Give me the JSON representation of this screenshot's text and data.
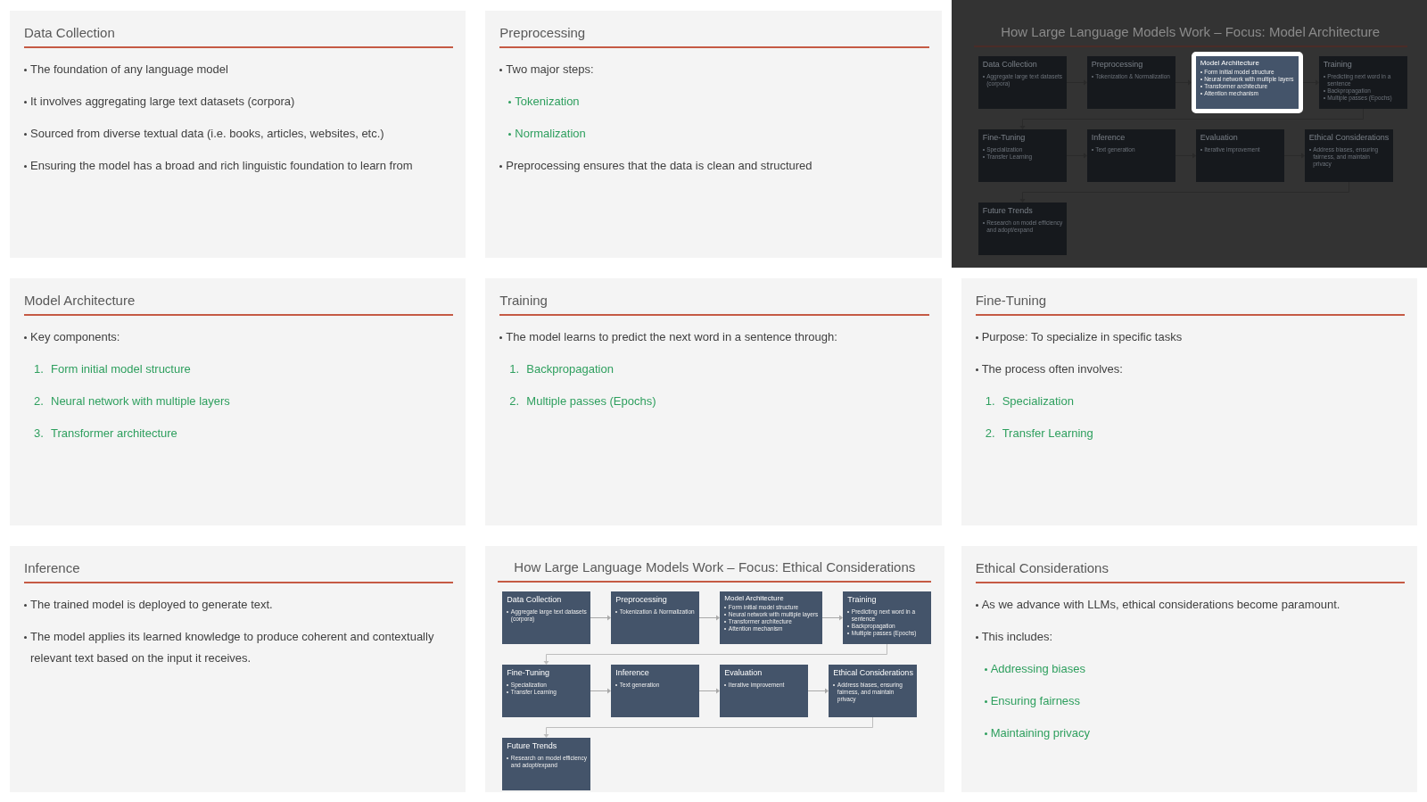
{
  "slides": [
    {
      "kind": "text",
      "dimmed": false,
      "title": "Data Collection",
      "items": [
        {
          "kind": "bullet",
          "text": "The foundation of any language model"
        },
        {
          "kind": "bullet",
          "text": "It involves aggregating large text datasets (corpora)"
        },
        {
          "kind": "bullet",
          "text": "Sourced from diverse textual data (i.e. books, articles, websites, etc.)"
        },
        {
          "kind": "bullet",
          "text": "Ensuring the model has a broad and rich linguistic foundation to learn from"
        }
      ]
    },
    {
      "kind": "text",
      "dimmed": false,
      "title": "Preprocessing",
      "items": [
        {
          "kind": "bullet",
          "text": "Two major steps:"
        },
        {
          "kind": "sub_bullet",
          "text": "Tokenization"
        },
        {
          "kind": "sub_bullet",
          "text": "Normalization"
        },
        {
          "kind": "bullet",
          "text": "Preprocessing ensures that the data is clean and structured"
        }
      ]
    },
    {
      "kind": "diagram",
      "dimmed": true,
      "title": "How Large Language Models Work – Focus: Model Architecture",
      "rows": [
        {
          "boxes": [
            {
              "title": "Data Collection",
              "selected": false,
              "bullets": [
                "Aggregate large text datasets (corpora)"
              ]
            },
            {
              "title": "Preprocessing",
              "selected": false,
              "bullets": [
                "Tokenization & Normalization"
              ]
            },
            {
              "title": "Model Architecture",
              "selected": true,
              "bullets": [
                "Form initial model structure",
                "Neural network with multiple layers",
                "Transformer architecture",
                "Attention mechanism"
              ]
            },
            {
              "title": "Training",
              "selected": false,
              "bullets": [
                "Predicting next word in a sentence",
                "Backpropagation",
                "Multiple passes (Epochs)"
              ]
            }
          ]
        },
        {
          "boxes": [
            {
              "title": "Fine-Tuning",
              "selected": false,
              "bullets": [
                "Specialization",
                "Transfer Learning"
              ]
            },
            {
              "title": "Inference",
              "selected": false,
              "bullets": [
                "Text generation"
              ]
            },
            {
              "title": "Evaluation",
              "selected": false,
              "bullets": [
                "Iterative improvement"
              ]
            },
            {
              "title": "Ethical Considerations",
              "selected": false,
              "bullets": [
                "Address biases, ensuring fairness, and maintain privacy"
              ]
            }
          ]
        },
        {
          "boxes": [
            {
              "title": "Future Trends",
              "selected": false,
              "bullets": [
                "Research on model efficiency and adopt/expand"
              ]
            }
          ]
        }
      ]
    },
    {
      "kind": "text",
      "dimmed": false,
      "title": "Model Architecture",
      "items": [
        {
          "kind": "bullet",
          "text": "Key components:"
        },
        {
          "kind": "numbered",
          "number": "1.",
          "text": "Form initial model structure"
        },
        {
          "kind": "numbered",
          "number": "2.",
          "text": "Neural network with multiple layers"
        },
        {
          "kind": "numbered",
          "number": "3.",
          "text": "Transformer architecture"
        }
      ]
    },
    {
      "kind": "text",
      "dimmed": false,
      "title": "Training",
      "items": [
        {
          "kind": "bullet",
          "text": "The model learns to predict the next word in a sentence through:"
        },
        {
          "kind": "numbered",
          "number": "1.",
          "text": "Backpropagation"
        },
        {
          "kind": "numbered",
          "number": "2.",
          "text": "Multiple passes (Epochs)"
        }
      ]
    },
    {
      "kind": "text",
      "dimmed": false,
      "title": "Fine-Tuning",
      "items": [
        {
          "kind": "bullet",
          "text": "Purpose: To specialize in specific tasks"
        },
        {
          "kind": "bullet",
          "text": "The process often involves:"
        },
        {
          "kind": "numbered",
          "number": "1.",
          "text": "Specialization"
        },
        {
          "kind": "numbered",
          "number": "2.",
          "text": "Transfer Learning"
        }
      ]
    },
    {
      "kind": "text",
      "dimmed": false,
      "title": "Inference",
      "items": [
        {
          "kind": "bullet",
          "text": "The trained model is deployed to generate text."
        },
        {
          "kind": "bullet",
          "text": "The model applies its learned knowledge to produce coherent and contextually relevant text based on the input it receives."
        }
      ]
    },
    {
      "kind": "diagram",
      "dimmed": false,
      "title": "How Large Language Models Work – Focus: Ethical Considerations",
      "rows": [
        {
          "boxes": [
            {
              "title": "Data Collection",
              "selected": false,
              "bullets": [
                "Aggregate large text datasets (corpora)"
              ]
            },
            {
              "title": "Preprocessing",
              "selected": false,
              "bullets": [
                "Tokenization & Normalization"
              ]
            },
            {
              "title": "Model Architecture",
              "selected": false,
              "bullets": [
                "Form initial model structure",
                "Neural network with multiple layers",
                "Transformer architecture",
                "Attention mechanism"
              ]
            },
            {
              "title": "Training",
              "selected": false,
              "bullets": [
                "Predicting next word in a sentence",
                "Backpropagation",
                "Multiple passes (Epochs)"
              ]
            }
          ]
        },
        {
          "boxes": [
            {
              "title": "Fine-Tuning",
              "selected": false,
              "bullets": [
                "Specialization",
                "Transfer Learning"
              ]
            },
            {
              "title": "Inference",
              "selected": false,
              "bullets": [
                "Text generation"
              ]
            },
            {
              "title": "Evaluation",
              "selected": false,
              "bullets": [
                "Iterative improvement"
              ]
            },
            {
              "title": "Ethical Considerations",
              "selected": false,
              "bullets": [
                "Address biases, ensuring fairness, and maintain privacy"
              ]
            }
          ]
        },
        {
          "boxes": [
            {
              "title": "Future Trends",
              "selected": false,
              "bullets": [
                "Research on model efficiency and adopt/expand"
              ]
            }
          ]
        }
      ]
    },
    {
      "kind": "text",
      "dimmed": false,
      "title": "Ethical Considerations",
      "items": [
        {
          "kind": "bullet",
          "text": "As we advance with LLMs, ethical considerations become paramount."
        },
        {
          "kind": "bullet",
          "text": "This includes:"
        },
        {
          "kind": "sub_bullet",
          "text": "Addressing biases"
        },
        {
          "kind": "sub_bullet",
          "text": "Ensuring fairness"
        },
        {
          "kind": "sub_bullet",
          "text": "Maintaining privacy"
        }
      ]
    }
  ]
}
